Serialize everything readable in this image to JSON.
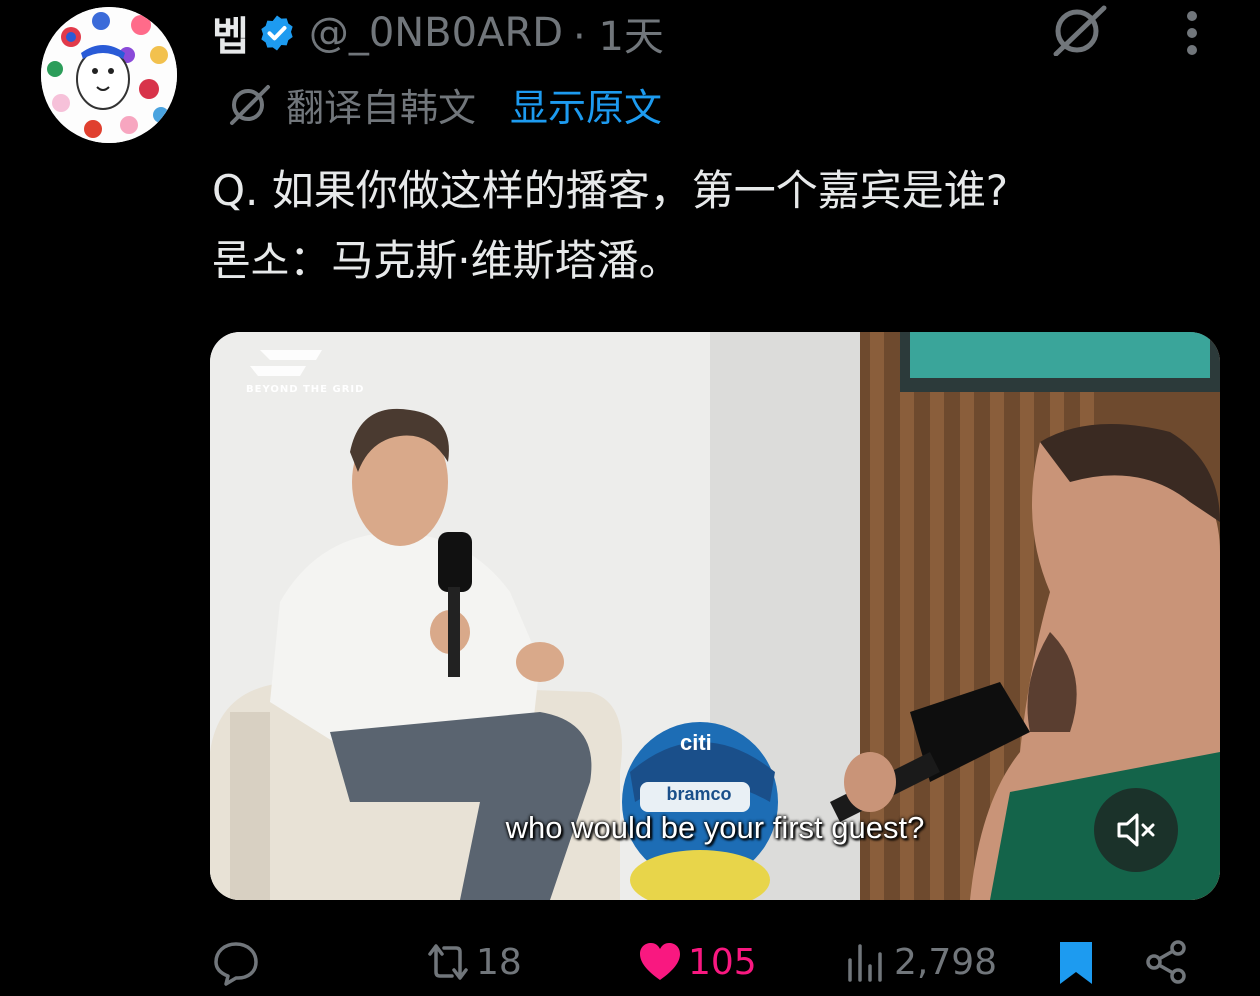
{
  "tweet": {
    "author_name": "벱",
    "handle": "@_0NB0ARD",
    "time": "· 1天",
    "translation_note": "翻译自韩文",
    "show_original": "显示原文",
    "text": "Q. 如果你做这样的播客，第一个嘉宾是谁?\n론소：马克斯·维斯塔潘。"
  },
  "media": {
    "subtitle": "who would be your first guest?",
    "logo_text": "BEYOND THE GRID",
    "helmet_sponsor": "bramco",
    "helmet_bank": "citi",
    "mute_icon": "volume-muted-icon"
  },
  "actions": {
    "reply_count": "",
    "retweet_count": "18",
    "like_count": "105",
    "views_count": "2,798"
  },
  "colors": {
    "accent": "#1d9bf0",
    "like": "#f91880",
    "muted_text": "#71767b"
  }
}
